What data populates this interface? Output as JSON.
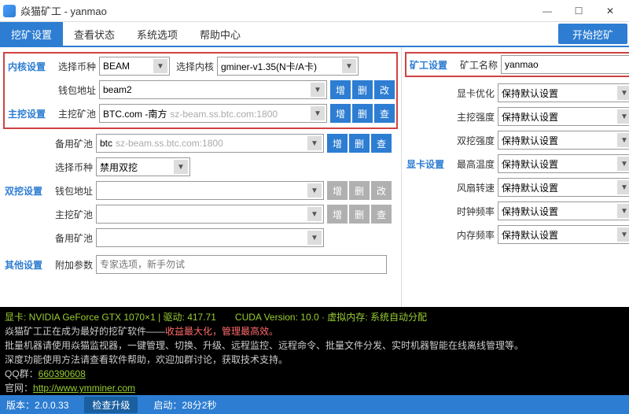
{
  "window": {
    "title": "焱猫矿工 - yanmao",
    "min": "—",
    "max": "☐",
    "close": "✕"
  },
  "tabs": {
    "items": [
      "挖矿设置",
      "查看状态",
      "系统选项",
      "帮助中心"
    ],
    "start": "开始挖矿"
  },
  "left": {
    "kernel_section": "内核设置",
    "main_section": "主挖设置",
    "dual_section": "双挖设置",
    "other_section": "其他设置",
    "coin_label": "选择币种",
    "coin_value": "BEAM",
    "kernel_label": "选择内核",
    "kernel_value": "gminer-v1.35(N卡/A卡)",
    "wallet_label": "钱包地址",
    "wallet_value": "beam2",
    "pool_label": "主挖矿池",
    "pool_value": "BTC.com -南方",
    "pool_hint": "sz-beam.ss.btc.com:1800",
    "backup_label": "备用矿池",
    "backup_value": "btc",
    "backup_hint": "sz-beam.ss.btc.com:1800",
    "dual_coin_label": "选择币种",
    "dual_coin_value": "禁用双挖",
    "dual_wallet_label": "钱包地址",
    "dual_pool_label": "主挖矿池",
    "dual_backup_label": "备用矿池",
    "extra_label": "附加参数",
    "extra_placeholder": "专家选项，新手勿试",
    "btn_add": "增",
    "btn_del": "删",
    "btn_mod": "改",
    "btn_chk": "查"
  },
  "right": {
    "miner_section": "矿工设置",
    "gpu_section": "显卡设置",
    "name_label": "矿工名称",
    "name_value": "yanmao",
    "gpu_opt_label": "显卡优化",
    "main_int_label": "主挖强度",
    "dual_int_label": "双挖强度",
    "temp_label": "最高温度",
    "fan_label": "风扇转速",
    "clock_label": "时钟频率",
    "mem_label": "内存频率",
    "default_value": "保持默认设置"
  },
  "console": {
    "line1": "显卡: NVIDIA GeForce GTX 1070×1 | 驱动: 417.71　　CUDA Version: 10.0 · 虚拟内存: 系统自动分配",
    "line2a": "焱猫矿工正在成为最好的挖矿软件——",
    "line2b": "收益最大化，管理最高效。",
    "line3": "批量机器请使用焱猫监视器，一键管理、切换、升级、远程监控、远程命令、批量文件分发、实时机器智能在线离线管理等。",
    "line4": "深度功能使用方法请查看软件帮助，欢迎加群讨论，获取技术支持。",
    "line5a": "QQ群：",
    "line5b": "660390608",
    "line6a": "官网：",
    "line6b": "http://www.ymminer.com"
  },
  "status": {
    "version_label": "版本：",
    "version": "2.0.0.33",
    "upgrade": "检查升级",
    "uptime_label": "启动：",
    "uptime": "28分2秒"
  }
}
